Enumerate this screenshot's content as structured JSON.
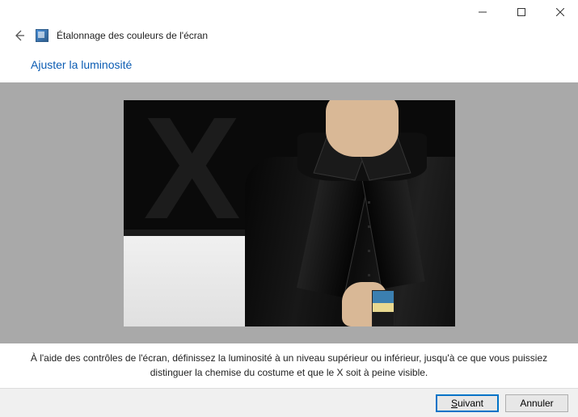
{
  "window": {
    "title": "Étalonnage des couleurs de l'écran"
  },
  "page": {
    "heading": "Ajuster la luminosité",
    "instruction": "À l'aide des contrôles de l'écran, définissez la luminosité à un niveau supérieur ou inférieur, jusqu'à ce que vous puissiez distinguer la chemise du costume et que le X soit à peine visible."
  },
  "buttons": {
    "next_prefix": "S",
    "next_rest": "uivant",
    "cancel": "Annuler"
  }
}
